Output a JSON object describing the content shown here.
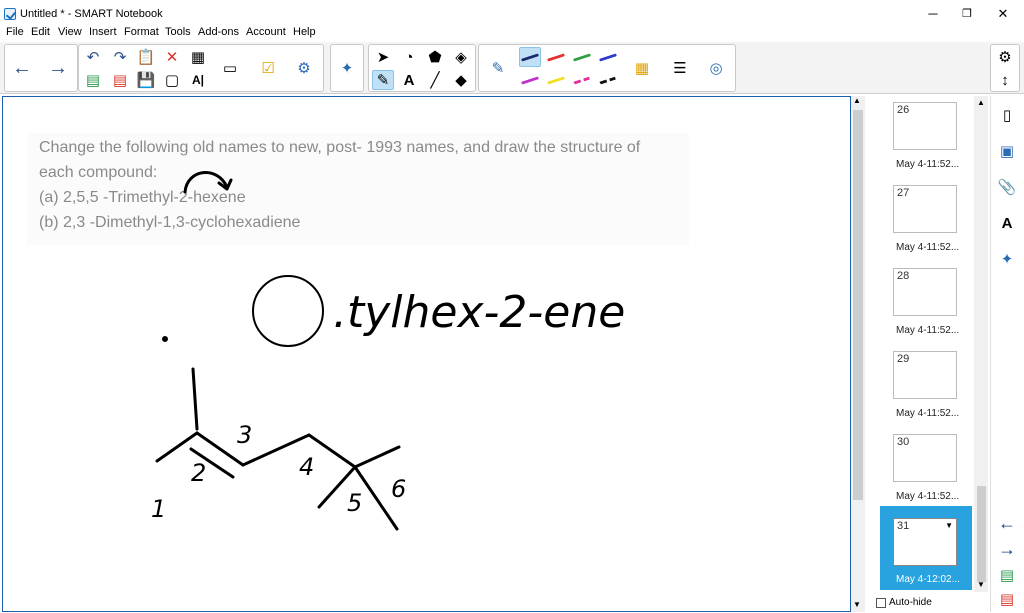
{
  "window": {
    "title": "Untitled * - SMART Notebook",
    "minimize": "─",
    "restore": "❐",
    "close": "✕"
  },
  "menu": [
    "File",
    "Edit",
    "View",
    "Insert",
    "Format",
    "Tools",
    "Add-ons",
    "Account",
    "Help"
  ],
  "canvas": {
    "question_lines": [
      "Change the following old names to new, post- 1993 names, and draw the structure of",
      "each compound:",
      "(a) 2,5,5 -Trimethyl-2-hexene",
      "(b) 2,3 -Dimethyl-1,3-cyclohexadiene"
    ],
    "handwritten_name": ".tylhex-2-ene",
    "carbon_numbers": [
      "1",
      "2",
      "3",
      "4",
      "5",
      "6"
    ]
  },
  "page_sorter": {
    "pages": [
      {
        "number": "26",
        "label": "May 4-11:52..."
      },
      {
        "number": "27",
        "label": "May 4-11:52..."
      },
      {
        "number": "28",
        "label": "May 4-11:52..."
      },
      {
        "number": "29",
        "label": "May 4-11:52..."
      },
      {
        "number": "30",
        "label": "May 4-11:52..."
      },
      {
        "number": "31",
        "label": "May 4-12:02..."
      }
    ],
    "selected_index": 5,
    "autohide_label": "Auto-hide"
  },
  "colors": {
    "accent": "#29a3e0",
    "canvas_border": "#1b5fae",
    "question_text": "#8a8a8a"
  }
}
